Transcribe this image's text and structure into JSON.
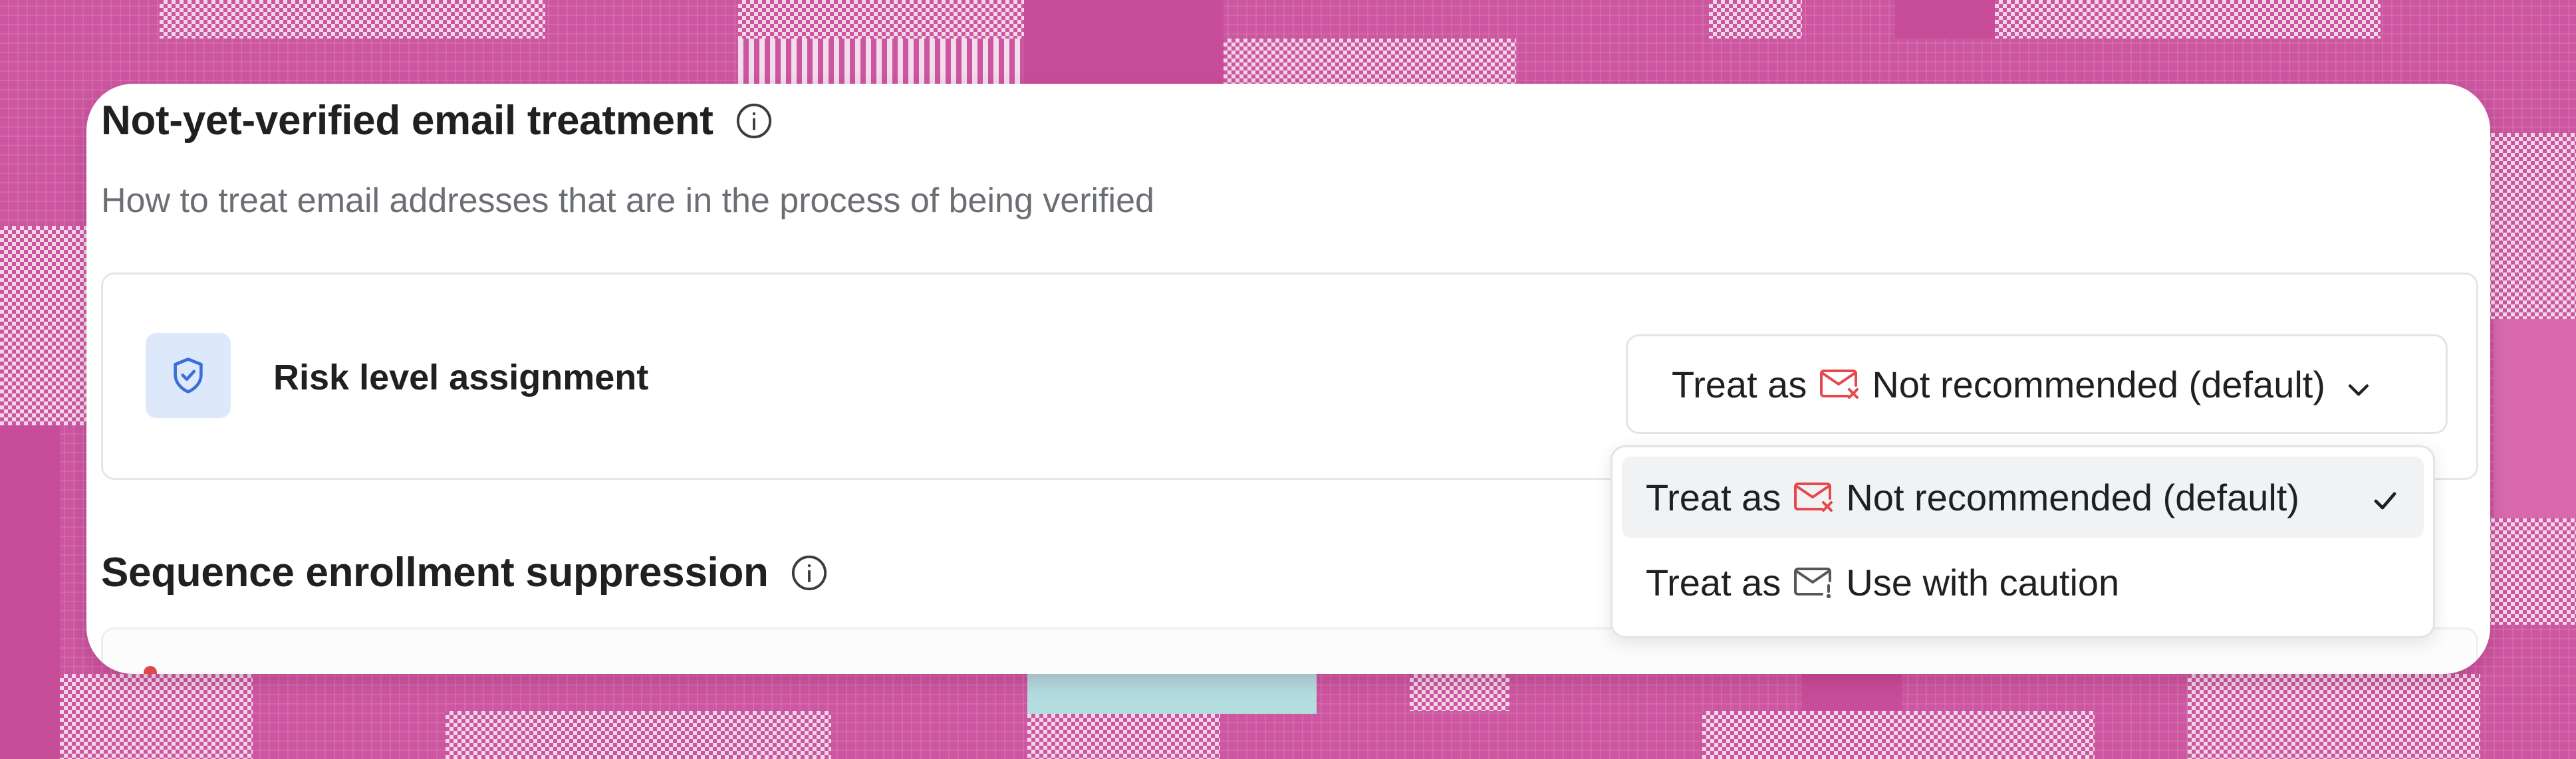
{
  "section1": {
    "title": "Not-yet-verified email treatment",
    "description": "How to treat email addresses that are in the process of being verified"
  },
  "setting": {
    "label": "Risk level assignment",
    "select": {
      "prefix": "Treat as",
      "value": "Not recommended (default)"
    }
  },
  "section2": {
    "title": "Sequence enrollment suppression"
  },
  "dropdown": {
    "options": [
      {
        "prefix": "Treat as",
        "label": "Not recommended (default)",
        "icon": "mail-x-icon",
        "selected": true
      },
      {
        "prefix": "Treat as",
        "label": "Use with caution",
        "icon": "mail-warning-icon",
        "selected": false
      }
    ]
  },
  "colors": {
    "background": "#cd56a0",
    "danger": "#e5484d",
    "accent": "#3b6fd8",
    "text": "#1f2022",
    "muted": "#6b6e73"
  }
}
